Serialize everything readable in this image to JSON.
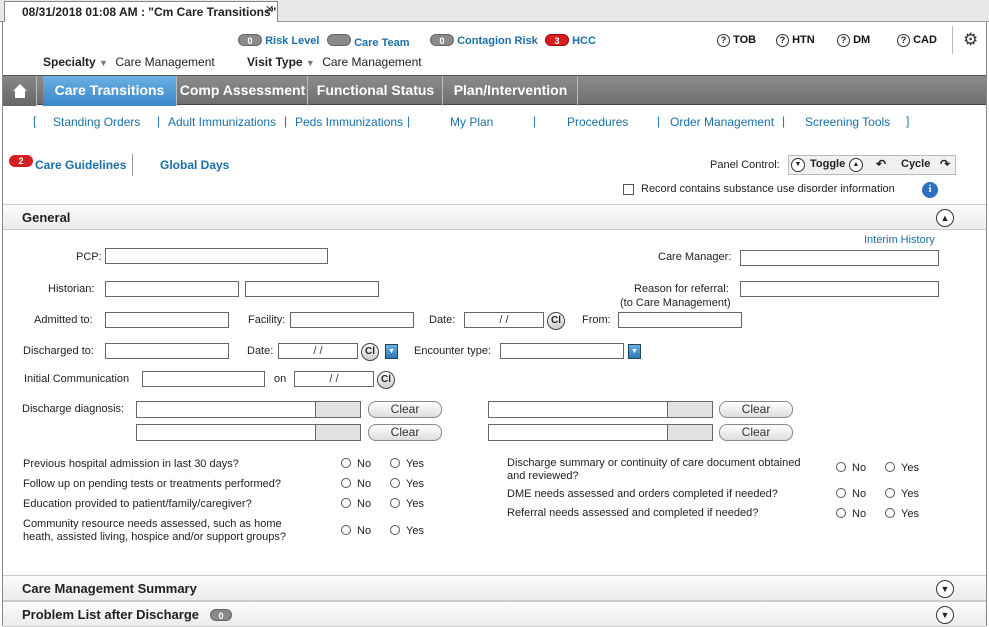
{
  "window": {
    "tab_title": "08/31/2018 01:08 AM : \"Cm Care Transitions\"",
    "close": "✕"
  },
  "header": {
    "badges": [
      {
        "count": "0",
        "label": "Risk Level"
      },
      {
        "count": "",
        "label": "Care Team"
      },
      {
        "count": "0",
        "label": "Contagion Risk"
      },
      {
        "count": "3",
        "label": "HCC",
        "color": "#d42020"
      }
    ],
    "specialty_label": "Specialty",
    "specialty_value": "Care Management",
    "visit_type_label": "Visit Type",
    "visit_type_value": "Care Management",
    "right_items": [
      "TOB",
      "HTN",
      "DM",
      "CAD"
    ],
    "help_glyph": "?",
    "gear_glyph": "⚙"
  },
  "nav": {
    "tabs": [
      "Care Transitions",
      "Comp Assessment",
      "Functional Status",
      "Plan/Intervention"
    ],
    "active": "Care Transitions",
    "subnav": [
      "Standing Orders",
      "Adult Immunizations",
      "Peds Immunizations",
      "My Plan",
      "Procedures",
      "Order Management",
      "Screening Tools"
    ]
  },
  "toolbar": {
    "guidelines_count": "2",
    "guidelines_label": "Care Guidelines",
    "global_days_label": "Global Days",
    "panel_control_label": "Panel Control:",
    "toggle_label": "Toggle",
    "cycle_label": "Cycle",
    "substance_label": "Record contains substance use disorder information"
  },
  "general": {
    "title": "General",
    "interim_history": "Interim History",
    "pcp_label": "PCP:",
    "care_manager_label": "Care Manager:",
    "historian_label": "Historian:",
    "reason_label": "Reason for referral:",
    "reason_sub": "(to Care Management)",
    "admitted_label": "Admitted to:",
    "facility_label": "Facility:",
    "date_label": "Date:",
    "from_label": "From:",
    "discharged_label": "Discharged to:",
    "date2_label": "Date:",
    "encounter_label": "Encounter type:",
    "initial_comm_label": "Initial Communication",
    "on_label": "on",
    "date_placeholder": "/ /",
    "clock_glyph": "Cl",
    "discharge_diag_label": "Discharge diagnosis:",
    "clear_label": "Clear",
    "no_label": "No",
    "yes_label": "Yes",
    "questions_left": [
      "Previous hospital admission in last 30 days?",
      "Follow up on pending tests or treatments performed?",
      "Education provided to patient/family/caregiver?",
      "Community resource needs assessed, such as home heath, assisted living, hospice and/or support groups?"
    ],
    "questions_right": [
      "Discharge summary or continuity of care document obtained and reviewed?",
      "DME needs assessed and orders completed if needed?",
      "Referral needs assessed and completed if needed?"
    ]
  },
  "sections": {
    "care_mgmt_summary": "Care Management Summary",
    "problem_list": "Problem List after Discharge",
    "problem_count": "0"
  }
}
